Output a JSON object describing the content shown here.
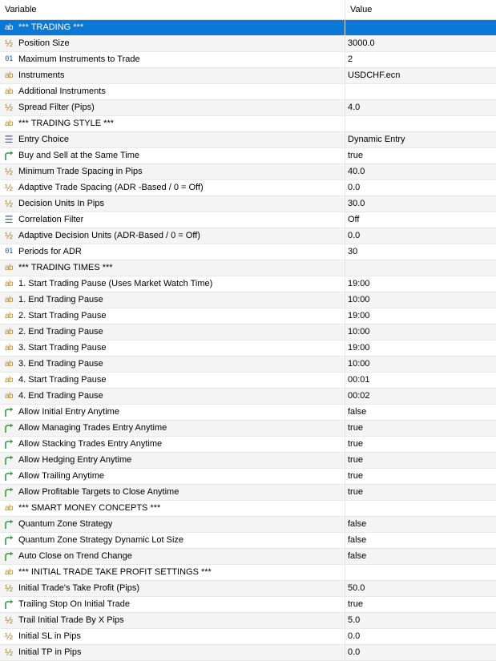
{
  "header": {
    "variable": "Variable",
    "value": "Value"
  },
  "icons": {
    "string": "ab-string-icon",
    "double": "half-double-icon",
    "int": "01-integer-icon",
    "enum": "enum-list-icon",
    "bool": "bool-arrow-icon"
  },
  "rows": [
    {
      "type": "string",
      "label": "*** TRADING ***",
      "value": "",
      "selected": true
    },
    {
      "type": "double",
      "label": "Position Size",
      "value": "3000.0"
    },
    {
      "type": "int",
      "label": "Maximum Instruments to Trade",
      "value": "2"
    },
    {
      "type": "string",
      "label": "Instruments",
      "value": "USDCHF.ecn"
    },
    {
      "type": "string",
      "label": "Additional Instruments",
      "value": ""
    },
    {
      "type": "double",
      "label": "Spread Filter (Pips)",
      "value": "4.0"
    },
    {
      "type": "string",
      "label": "*** TRADING STYLE ***",
      "value": ""
    },
    {
      "type": "enum",
      "label": "Entry Choice",
      "value": "Dynamic Entry"
    },
    {
      "type": "bool",
      "label": "Buy and Sell at the Same Time",
      "value": "true"
    },
    {
      "type": "double",
      "label": "Minimum Trade Spacing in Pips",
      "value": "40.0"
    },
    {
      "type": "double",
      "label": "Adaptive Trade Spacing (ADR -Based / 0 = Off)",
      "value": "0.0"
    },
    {
      "type": "double",
      "label": "Decision Units In Pips",
      "value": "30.0"
    },
    {
      "type": "enum",
      "label": "Correlation Filter",
      "value": "Off"
    },
    {
      "type": "double",
      "label": "Adaptive Decision Units (ADR-Based / 0 = Off)",
      "value": "0.0"
    },
    {
      "type": "int",
      "label": "Periods for ADR",
      "value": "30"
    },
    {
      "type": "string",
      "label": "*** TRADING TIMES ***",
      "value": ""
    },
    {
      "type": "string",
      "label": "1. Start Trading Pause (Uses Market Watch Time)",
      "value": "19:00"
    },
    {
      "type": "string",
      "label": "1. End Trading Pause",
      "value": "10:00"
    },
    {
      "type": "string",
      "label": "2. Start Trading Pause",
      "value": "19:00"
    },
    {
      "type": "string",
      "label": "2. End Trading Pause",
      "value": "10:00"
    },
    {
      "type": "string",
      "label": "3. Start Trading Pause",
      "value": "19:00"
    },
    {
      "type": "string",
      "label": "3. End Trading Pause",
      "value": "10:00"
    },
    {
      "type": "string",
      "label": "4. Start Trading Pause",
      "value": "00:01"
    },
    {
      "type": "string",
      "label": "4. End Trading Pause",
      "value": "00:02"
    },
    {
      "type": "bool",
      "label": "Allow Initial Entry Anytime",
      "value": "false"
    },
    {
      "type": "bool",
      "label": "Allow Managing Trades Entry Anytime",
      "value": "true"
    },
    {
      "type": "bool",
      "label": "Allow Stacking Trades Entry Anytime",
      "value": "true"
    },
    {
      "type": "bool",
      "label": "Allow Hedging Entry Anytime",
      "value": "true"
    },
    {
      "type": "bool",
      "label": "Allow Trailing Anytime",
      "value": "true"
    },
    {
      "type": "bool",
      "label": "Allow Profitable Targets to Close Anytime",
      "value": "true"
    },
    {
      "type": "string",
      "label": "*** SMART MONEY CONCEPTS ***",
      "value": ""
    },
    {
      "type": "bool",
      "label": "Quantum Zone Strategy",
      "value": "false"
    },
    {
      "type": "bool",
      "label": "Quantum Zone Strategy Dynamic Lot Size",
      "value": "false"
    },
    {
      "type": "bool",
      "label": "Auto Close on Trend Change",
      "value": "false"
    },
    {
      "type": "string",
      "label": "*** INITIAL TRADE TAKE PROFIT SETTINGS ***",
      "value": ""
    },
    {
      "type": "double",
      "label": "Initial Trade's Take Profit (Pips)",
      "value": "50.0"
    },
    {
      "type": "bool",
      "label": "Trailing Stop On Initial Trade",
      "value": "true"
    },
    {
      "type": "double",
      "label": "Trail Initial Trade By X Pips",
      "value": "5.0"
    },
    {
      "type": "double",
      "label": "Initial SL in Pips",
      "value": "0.0"
    },
    {
      "type": "double",
      "label": "Initial TP in Pips",
      "value": "0.0"
    }
  ]
}
